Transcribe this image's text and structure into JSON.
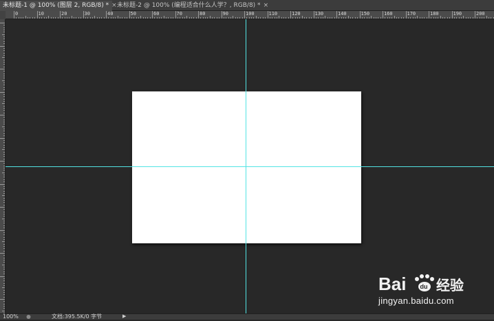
{
  "tabs": [
    {
      "title": "未标题-1 @ 100% (图层 2, RGB/8) *",
      "close": "×",
      "active": true
    },
    {
      "title": "未标题-2 @ 100% (编程适合什么人学？, RGB/8) *",
      "close": "×",
      "active": false
    }
  ],
  "ruler": {
    "top_labels": [
      "0",
      "10",
      "20",
      "30",
      "40",
      "50",
      "60",
      "70",
      "80",
      "90",
      "100",
      "110",
      "120",
      "130",
      "140",
      "150",
      "160",
      "170",
      "180",
      "190",
      "200"
    ]
  },
  "status": {
    "zoom": "100%",
    "doc_info": "文档:395.5K/0 字节",
    "arrow": "▶"
  },
  "colors": {
    "guide": "#52e4e4",
    "workspace": "#282828",
    "document": "#ffffff"
  },
  "watermark": {
    "brand": "Baidu经验",
    "sub": "jingyan.baidu.com"
  }
}
